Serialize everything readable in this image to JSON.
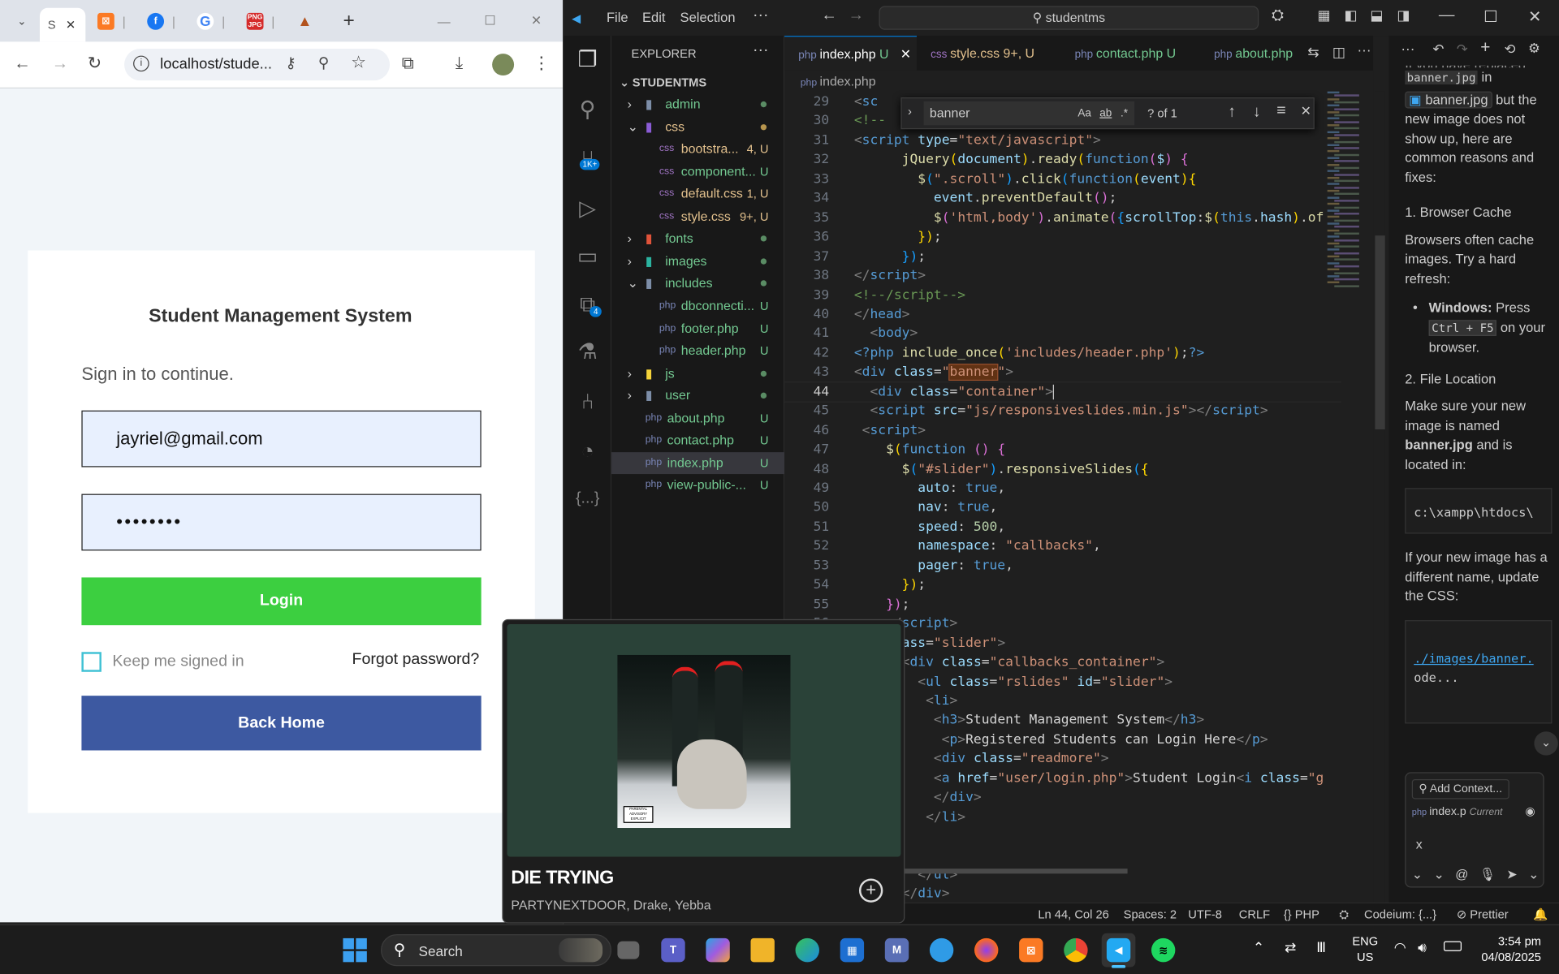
{
  "browser": {
    "tabs": [
      {
        "label": "S",
        "close": "✕"
      },
      {
        "label": "X"
      },
      {
        "label": "f"
      },
      {
        "label": "G"
      },
      {
        "label": "PNG JPG"
      },
      {
        "label": "▲"
      }
    ],
    "new_tab": "+",
    "url": "localhost/stude...",
    "login": {
      "title": "Student Management System",
      "subtitle": "Sign in to continue.",
      "email_value": "jayriel@gmail.com",
      "password_value": "••••••••",
      "login_label": "Login",
      "keep_label": "Keep me signed in",
      "forgot_label": "Forgot password?",
      "back_label": "Back Home"
    },
    "colors": {
      "login": "#3ccf40",
      "back": "#3d59a1"
    }
  },
  "vscode": {
    "menu": [
      "File",
      "Edit",
      "Selection",
      "···"
    ],
    "search": "studentms",
    "explorer": {
      "header": "EXPLORER",
      "root": "STUDENTMS",
      "items": [
        {
          "label": "admin",
          "type": "folder",
          "status": "dot-green"
        },
        {
          "label": "css",
          "type": "folder-open",
          "status": "dot-yellow"
        },
        {
          "label": "bootstra...",
          "type": "css",
          "status": "4, U"
        },
        {
          "label": "component...",
          "type": "css",
          "status": "U"
        },
        {
          "label": "default.css",
          "type": "css",
          "status": "1, U"
        },
        {
          "label": "style.css",
          "type": "css",
          "status": "9+, U"
        },
        {
          "label": "fonts",
          "type": "folder",
          "status": "dot-green"
        },
        {
          "label": "images",
          "type": "folder",
          "status": "dot-green"
        },
        {
          "label": "includes",
          "type": "folder-open",
          "status": "dot-green"
        },
        {
          "label": "dbconnecti...",
          "type": "php",
          "status": "U"
        },
        {
          "label": "footer.php",
          "type": "php",
          "status": "U"
        },
        {
          "label": "header.php",
          "type": "php",
          "status": "U"
        },
        {
          "label": "js",
          "type": "folder",
          "status": "dot-green"
        },
        {
          "label": "user",
          "type": "folder",
          "status": "dot-green"
        },
        {
          "label": "about.php",
          "type": "php",
          "status": "U"
        },
        {
          "label": "contact.php",
          "type": "php",
          "status": "U"
        },
        {
          "label": "index.php",
          "type": "php",
          "status": "U"
        },
        {
          "label": "view-public-...",
          "type": "php",
          "status": "U"
        }
      ]
    },
    "tabs": [
      {
        "label": "index.php",
        "status": "U",
        "active": true
      },
      {
        "label": "style.css",
        "status": "9+, U"
      },
      {
        "label": "contact.php",
        "status": "U"
      },
      {
        "label": "about.php",
        "status": ""
      }
    ],
    "breadcrumb": "index.php",
    "find": {
      "query": "banner",
      "result": "? of 1",
      "aa": "Aa",
      "ab": "ab",
      "re": ".*"
    },
    "status": {
      "position": "Ln 44, Col 26",
      "spaces": "Spaces: 2",
      "encoding": "UTF-8",
      "eol": "CRLF",
      "lang": "{} PHP",
      "codeium": "Codeium: {...}",
      "prettier": "Prettier"
    },
    "code_lines": [
      {
        "n": "29",
        "html": "<span class='p'>&lt;</span><span class='k'>sc</span>"
      },
      {
        "n": "30",
        "html": "<span class='c'>&lt;!--</span>"
      },
      {
        "n": "31",
        "html": "<span class='p'>&lt;</span><span class='k'>script</span> <span class='a'>type</span><span class='w'>=</span><span class='s'>\"text/javascript\"</span><span class='p'>&gt;</span>"
      },
      {
        "n": "32",
        "html": "      <span class='f'>jQuery</span><span class='y'>(</span><span class='a'>document</span><span class='y'>)</span>.<span class='f'>ready</span><span class='y'>(</span><span class='k'>function</span><span class='m'>(</span><span class='a'>$</span><span class='m'>)</span> <span class='m'>{</span>"
      },
      {
        "n": "33",
        "html": "        <span class='f'>$</span><span class='bl'>(</span><span class='s'>\".scroll\"</span><span class='bl'>)</span>.<span class='f'>click</span><span class='bl'>(</span><span class='k'>function</span><span class='y'>(</span><span class='a'>event</span><span class='y'>){</span>"
      },
      {
        "n": "34",
        "html": "          <span class='a'>event</span>.<span class='f'>preventDefault</span><span class='m'>()</span>;"
      },
      {
        "n": "35",
        "html": "          <span class='f'>$</span><span class='m'>(</span><span class='s'>'html,body'</span><span class='m'>)</span>.<span class='f'>animate</span><span class='m'>(</span><span class='bl'>{</span><span class='a'>scrollTop</span>:<span class='f'>$</span><span class='y'>(</span><span class='k'>this</span>.<span class='a'>hash</span><span class='y'>)</span>.<span class='f'>of</span>"
      },
      {
        "n": "36",
        "html": "        <span class='y'>})</span>;"
      },
      {
        "n": "37",
        "html": "      <span class='bl'>})</span>;"
      },
      {
        "n": "38",
        "html": "<span class='p'>&lt;/</span><span class='k'>script</span><span class='p'>&gt;</span>"
      },
      {
        "n": "39",
        "html": "<span class='c'>&lt;!--/script--&gt;</span>"
      },
      {
        "n": "40",
        "html": "<span class='p'>&lt;/</span><span class='k'>head</span><span class='p'>&gt;</span>"
      },
      {
        "n": "41",
        "html": "  <span class='p'>&lt;</span><span class='k'>body</span><span class='p'>&gt;</span>"
      },
      {
        "n": "42",
        "html": "<span class='k'>&lt;?php</span> <span class='f'>include_once</span><span class='y'>(</span><span class='s'>'includes/header.php'</span><span class='y'>)</span>;<span class='k'>?&gt;</span>"
      },
      {
        "n": "43",
        "html": "<span class='p'>&lt;</span><span class='k'>div</span> <span class='a'>class</span>=<span class='s'>\"<span style='background:#613214;outline:1px solid #a0522d'>banner</span>\"</span><span class='p'>&gt;</span>"
      },
      {
        "n": "44",
        "html": "  <span class='p'>&lt;</span><span class='k'>div</span> <span class='a'>class</span>=<span class='s'>\"container\"</span><span class='p'>&gt;</span><span style='border-left:1px solid #ccc'> </span>"
      },
      {
        "n": "45",
        "html": "  <span class='p'>&lt;</span><span class='k'>script</span> <span class='a'>src</span>=<span class='s'>\"js/responsiveslides.min.js\"</span><span class='p'>&gt;&lt;/</span><span class='k'>script</span><span class='p'>&gt;</span>"
      },
      {
        "n": "46",
        "html": " <span class='p'>&lt;</span><span class='k'>script</span><span class='p'>&gt;</span>"
      },
      {
        "n": "47",
        "html": "    <span class='f'>$</span><span class='y'>(</span><span class='k'>function</span> <span class='m'>()</span> <span class='m'>{</span>"
      },
      {
        "n": "48",
        "html": "      <span class='f'>$</span><span class='bl'>(</span><span class='s'>\"#slider\"</span><span class='bl'>)</span>.<span class='f'>responsiveSlides</span><span class='bl'>(</span><span class='y'>{</span>"
      },
      {
        "n": "49",
        "html": "        <span class='a'>auto</span>: <span class='k'>true</span>,"
      },
      {
        "n": "50",
        "html": "        <span class='a'>nav</span>: <span class='k'>true</span>,"
      },
      {
        "n": "51",
        "html": "        <span class='a'>speed</span>: <span class='n'>500</span>,"
      },
      {
        "n": "52",
        "html": "        <span class='a'>namespace</span>: <span class='s'>\"callbacks\"</span>,"
      },
      {
        "n": "53",
        "html": "        <span class='a'>pager</span>: <span class='k'>true</span>,"
      },
      {
        "n": "54",
        "html": "      <span class='y'>})</span>;"
      },
      {
        "n": "55",
        "html": "    <span class='m'>})</span>;"
      },
      {
        "n": "56",
        "html": "    <span class='p'>&lt;/</span><span class='k'>script</span><span class='p'>&gt;</span>"
      },
      {
        "n": "57",
        "html": "    <span class='a'>class</span>=<span class='s'>\"slider\"</span><span class='p'>&gt;</span>"
      },
      {
        "n": "58",
        "html": "      <span class='p'>&lt;</span><span class='k'>div</span> <span class='a'>class</span>=<span class='s'>\"callbacks_container\"</span><span class='p'>&gt;</span>"
      },
      {
        "n": "59",
        "html": "        <span class='p'>&lt;</span><span class='k'>ul</span> <span class='a'>class</span>=<span class='s'>\"rslides\"</span> <span class='a'>id</span>=<span class='s'>\"slider\"</span><span class='p'>&gt;</span>"
      },
      {
        "n": "60",
        "html": "         <span class='p'>&lt;</span><span class='k'>li</span><span class='p'>&gt;</span>"
      },
      {
        "n": "61",
        "html": "          <span class='p'>&lt;</span><span class='k'>h3</span><span class='p'>&gt;</span><span class='w'>Student Management System</span><span class='p'>&lt;/</span><span class='k'>h3</span><span class='p'>&gt;</span>"
      },
      {
        "n": "62",
        "html": "           <span class='p'>&lt;</span><span class='k'>p</span><span class='p'>&gt;</span><span class='w'>Registered Students can Login Here</span><span class='p'>&lt;/</span><span class='k'>p</span><span class='p'>&gt;</span>"
      },
      {
        "n": "63",
        "html": "          <span class='p'>&lt;</span><span class='k'>div</span> <span class='a'>class</span>=<span class='s'>\"readmore\"</span><span class='p'>&gt;</span>"
      },
      {
        "n": "64",
        "html": "          <span class='p'>&lt;</span><span class='k'>a</span> <span class='a'>href</span>=<span class='s'>\"user/login.php\"</span><span class='p'>&gt;</span><span class='w'>Student Login</span><span class='p'>&lt;</span><span class='k'>i</span> <span class='a'>class</span>=<span class='s'>\"g</span>"
      },
      {
        "n": "65",
        "html": "          <span class='p'>&lt;/</span><span class='k'>div</span><span class='p'>&gt;</span>"
      },
      {
        "n": "66",
        "html": "         <span class='p'>&lt;/</span><span class='k'>li</span><span class='p'>&gt;</span>"
      },
      {
        "n": "67",
        "html": ""
      },
      {
        "n": "68",
        "html": ""
      },
      {
        "n": "69",
        "html": "        <span class='p'>&lt;/</span><span class='k'>ul</span><span class='p'>&gt;</span>"
      },
      {
        "n": "70",
        "html": "      <span class='p'>&lt;/</span><span class='k'>div</span><span class='p'>&gt;</span>"
      }
    ],
    "chat": {
      "p1a": "If you have replaced",
      "code1": "banner.jpg",
      "p1b": "in",
      "file1": "banner.jpg",
      "p1c": "but the new image does not show up, here are common reasons and fixes:",
      "h1": "1. Browser Cache",
      "p2": "Browsers often cache images. Try a hard refresh:",
      "li_bold": "Windows:",
      "li_a": "Press",
      "li_code": "Ctrl + F5",
      "li_b": "on your browser.",
      "h2": "2. File Location",
      "p3a": "Make sure your new image is named",
      "p3b": "banner.jpg",
      "p3c": "and is located in:",
      "path": "c:\\xampp\\htdocs\\",
      "p4": "If your new image has a different name, update the CSS:",
      "css1": "./images/banner.",
      "css2": "ode...",
      "add_context": "Add Context...",
      "current_file": "index.p",
      "current_tag": "Current",
      "input": "x"
    }
  },
  "media": {
    "title": "DIE TRYING",
    "artists": "PARTYNEXTDOOR, Drake, Yebba",
    "badge": "PARENTAL ADVISORY EXPLICIT CONTENT"
  },
  "taskbar": {
    "search": "Search",
    "lang1": "ENG",
    "lang2": "US",
    "time": "3:54 pm",
    "date": "04/08/2025"
  }
}
